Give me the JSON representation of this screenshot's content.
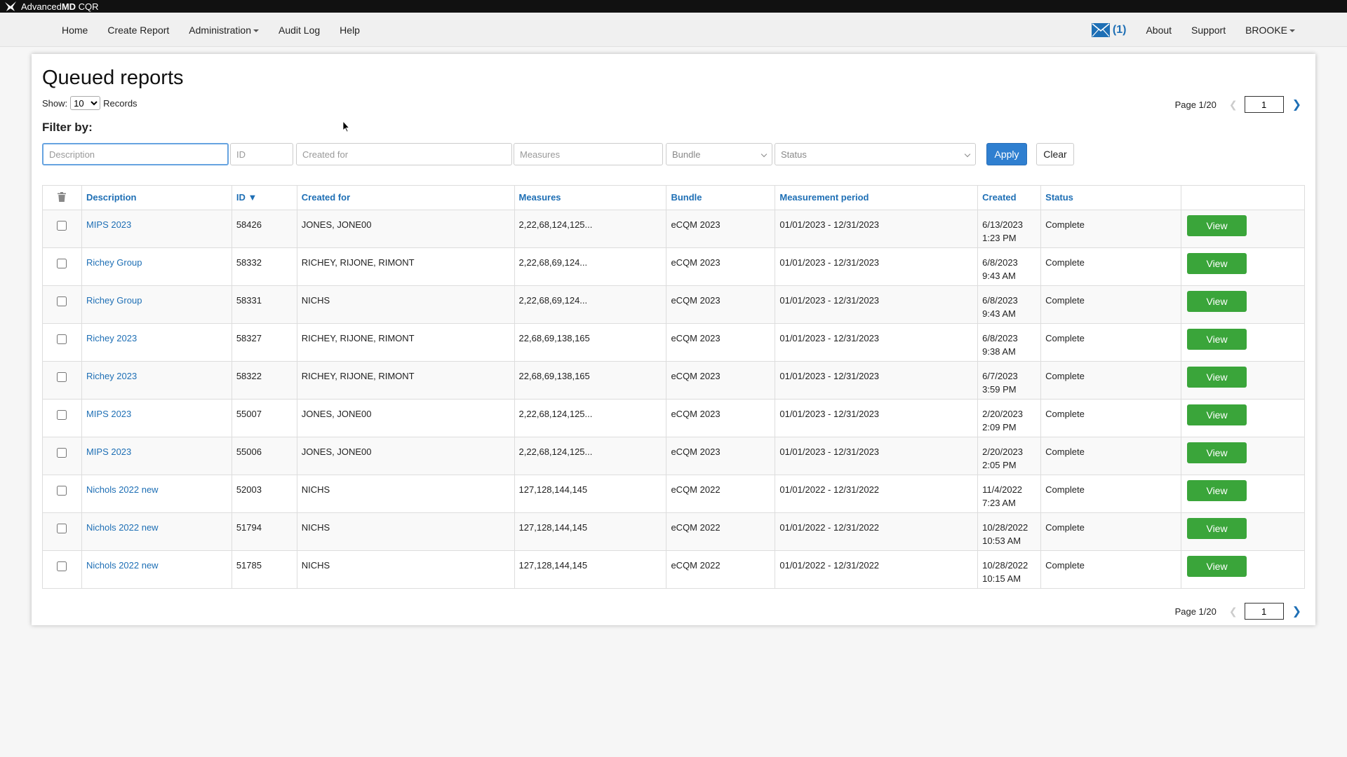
{
  "brand": {
    "prefix": "Advanced",
    "bold": "MD",
    "suffix": " CQR"
  },
  "nav": {
    "left": [
      {
        "label": "Home",
        "dropdown": false
      },
      {
        "label": "Create Report",
        "dropdown": false
      },
      {
        "label": "Administration",
        "dropdown": true
      },
      {
        "label": "Audit Log",
        "dropdown": false
      },
      {
        "label": "Help",
        "dropdown": false
      }
    ],
    "mail_count": "(1)",
    "about": "About",
    "support": "Support",
    "user": "BROOKE"
  },
  "page": {
    "title": "Queued reports",
    "show_label": "Show:",
    "show_value": "10",
    "records_label": "Records",
    "filter_label": "Filter by:",
    "pager_label": "Page 1/20",
    "page_input": "1",
    "bottom_pager_label": "Page 1/20",
    "bottom_page_input": "1"
  },
  "filters": {
    "description_placeholder": "Description",
    "id_placeholder": "ID",
    "created_for_placeholder": "Created for",
    "measures_placeholder": "Measures",
    "bundle_label": "Bundle",
    "status_label": "Status",
    "apply": "Apply",
    "clear": "Clear"
  },
  "table": {
    "headers": {
      "description": "Description",
      "id": "ID ▼",
      "created_for": "Created for",
      "measures": "Measures",
      "bundle": "Bundle",
      "period": "Measurement period",
      "created": "Created",
      "status": "Status"
    },
    "view_label": "View",
    "rows": [
      {
        "description": "MIPS 2023",
        "id": "58426",
        "created_for": "JONES, JONE00",
        "measures": "2,22,68,124,125...",
        "bundle": "eCQM 2023",
        "period": "01/01/2023 - 12/31/2023",
        "created_date": "6/13/2023",
        "created_time": "1:23 PM",
        "status": "Complete"
      },
      {
        "description": "Richey Group",
        "id": "58332",
        "created_for": "RICHEY, RIJONE, RIMONT",
        "measures": "2,22,68,69,124...",
        "bundle": "eCQM 2023",
        "period": "01/01/2023 - 12/31/2023",
        "created_date": "6/8/2023",
        "created_time": "9:43 AM",
        "status": "Complete"
      },
      {
        "description": "Richey Group",
        "id": "58331",
        "created_for": "NICHS",
        "measures": "2,22,68,69,124...",
        "bundle": "eCQM 2023",
        "period": "01/01/2023 - 12/31/2023",
        "created_date": "6/8/2023",
        "created_time": "9:43 AM",
        "status": "Complete"
      },
      {
        "description": "Richey 2023",
        "id": "58327",
        "created_for": "RICHEY, RIJONE, RIMONT",
        "measures": "22,68,69,138,165",
        "bundle": "eCQM 2023",
        "period": "01/01/2023 - 12/31/2023",
        "created_date": "6/8/2023",
        "created_time": "9:38 AM",
        "status": "Complete"
      },
      {
        "description": "Richey 2023",
        "id": "58322",
        "created_for": "RICHEY, RIJONE, RIMONT",
        "measures": "22,68,69,138,165",
        "bundle": "eCQM 2023",
        "period": "01/01/2023 - 12/31/2023",
        "created_date": "6/7/2023",
        "created_time": "3:59 PM",
        "status": "Complete"
      },
      {
        "description": "MIPS 2023",
        "id": "55007",
        "created_for": "JONES, JONE00",
        "measures": "2,22,68,124,125...",
        "bundle": "eCQM 2023",
        "period": "01/01/2023 - 12/31/2023",
        "created_date": "2/20/2023",
        "created_time": "2:09 PM",
        "status": "Complete"
      },
      {
        "description": "MIPS 2023",
        "id": "55006",
        "created_for": "JONES, JONE00",
        "measures": "2,22,68,124,125...",
        "bundle": "eCQM 2023",
        "period": "01/01/2023 - 12/31/2023",
        "created_date": "2/20/2023",
        "created_time": "2:05 PM",
        "status": "Complete"
      },
      {
        "description": "Nichols 2022 new",
        "id": "52003",
        "created_for": "NICHS",
        "measures": "127,128,144,145",
        "bundle": "eCQM 2022",
        "period": "01/01/2022 - 12/31/2022",
        "created_date": "11/4/2022",
        "created_time": "7:23 AM",
        "status": "Complete"
      },
      {
        "description": "Nichols 2022 new",
        "id": "51794",
        "created_for": "NICHS",
        "measures": "127,128,144,145",
        "bundle": "eCQM 2022",
        "period": "01/01/2022 - 12/31/2022",
        "created_date": "10/28/2022",
        "created_time": "10:53 AM",
        "status": "Complete"
      },
      {
        "description": "Nichols 2022 new",
        "id": "51785",
        "created_for": "NICHS",
        "measures": "127,128,144,145",
        "bundle": "eCQM 2022",
        "period": "01/01/2022 - 12/31/2022",
        "created_date": "10/28/2022",
        "created_time": "10:15 AM",
        "status": "Complete"
      }
    ]
  },
  "colors": {
    "link": "#1e6fb5",
    "view_button": "#3aa53a",
    "apply_button": "#2f7fd0",
    "brand_bar": "#111111"
  },
  "icons": {
    "logo": "advancedmd-logo-icon",
    "mail": "envelope-icon",
    "delete": "trash-icon",
    "next": "chevron-right-icon",
    "prev": "chevron-left-icon"
  }
}
